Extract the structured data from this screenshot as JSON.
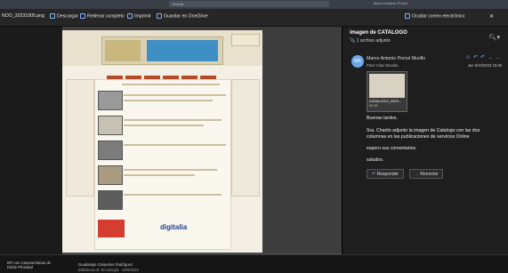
{
  "top_strip": {
    "search_text": "Buscar",
    "right_text": "Marco Antonio Porcel"
  },
  "toolbar": {
    "filename": "NOO_20231005.png",
    "download": "Descargar",
    "fill_sign": "Rellenar completo",
    "print": "Imprimir",
    "save_onedrive": "Guardar en OneDrive",
    "hide_email": "Ocultar correo electrónico"
  },
  "document": {
    "footer_logo_text": "digitalia"
  },
  "reading_pane": {
    "subject": "imagen de CATALOGO",
    "attachment_count": "1 archivo adjunto",
    "sender": "Marco Antonio Porcel Murillo",
    "avatar_initials": "MA",
    "recipient": "Para: Irina Yarovka",
    "date": "Jue 5/10/2023 15:46",
    "attachment": {
      "name": "CATALOGO_2023...",
      "size": "88 KB"
    },
    "body": [
      "Buenas tardes.",
      "Sra. Charito adjunto la imagen de Catalogo con las dos",
      "columnas en las publicaciones de servicios Online",
      "espero sus comentarios.",
      "saludos."
    ],
    "reply_label": "Responder",
    "forward_label": "Reenviar"
  },
  "taskbar": {
    "left_text": "BFI con Caracteristicas de Doble Prioridad",
    "center_text": "Guadalupe Céspedes Rodríguez",
    "center_subtext": "Biblioteca de Tecnología · 19/9/2023"
  }
}
